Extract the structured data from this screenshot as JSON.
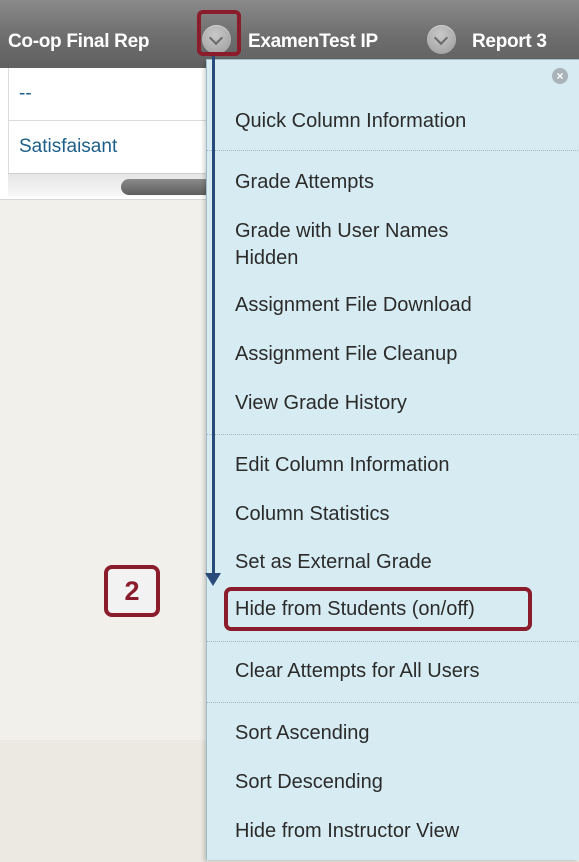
{
  "header": {
    "columns": [
      {
        "title": "Co-op Final Rep"
      },
      {
        "title": "ExamenTest IP"
      },
      {
        "title": "Report 3"
      }
    ]
  },
  "grid": {
    "cells": [
      {
        "value": "--"
      },
      {
        "value": "Satisfaisant"
      }
    ]
  },
  "menu": {
    "close_icon": "close-icon",
    "groups": [
      [
        "Quick Column Information"
      ],
      [
        "Grade Attempts",
        "Grade with User Names Hidden",
        "Assignment File Download",
        "Assignment File Cleanup",
        "View Grade History"
      ],
      [
        "Edit Column Information",
        "Column Statistics",
        "Set as External Grade",
        "Hide from Students (on/off)"
      ],
      [
        "Clear Attempts for All Users"
      ],
      [
        "Sort Ascending",
        "Sort Descending",
        "Hide from Instructor View"
      ]
    ],
    "items": {
      "quick_column_information": "Quick Column Information",
      "grade_attempts": "Grade Attempts",
      "grade_with_user_names_hidden_line1": "Grade with User Names",
      "grade_with_user_names_hidden_line2": "Hidden",
      "assignment_file_download": "Assignment File Download",
      "assignment_file_cleanup": "Assignment File Cleanup",
      "view_grade_history": "View Grade History",
      "edit_column_information": "Edit Column Information",
      "column_statistics": "Column Statistics",
      "set_as_external_grade": "Set as External Grade",
      "hide_from_students": "Hide from Students (on/off)",
      "clear_attempts_for_all_users": "Clear Attempts for All Users",
      "sort_ascending": "Sort Ascending",
      "sort_descending": "Sort Descending",
      "hide_from_instructor_view": "Hide from Instructor View"
    }
  },
  "annotation": {
    "step_number": "2",
    "accent_color": "#8b1c2b",
    "arrow_color": "#2a4b7a"
  },
  "colors": {
    "menu_background": "#d6ebf2",
    "header_background": "#6d6d6d",
    "link_color": "#1d5f8a"
  }
}
